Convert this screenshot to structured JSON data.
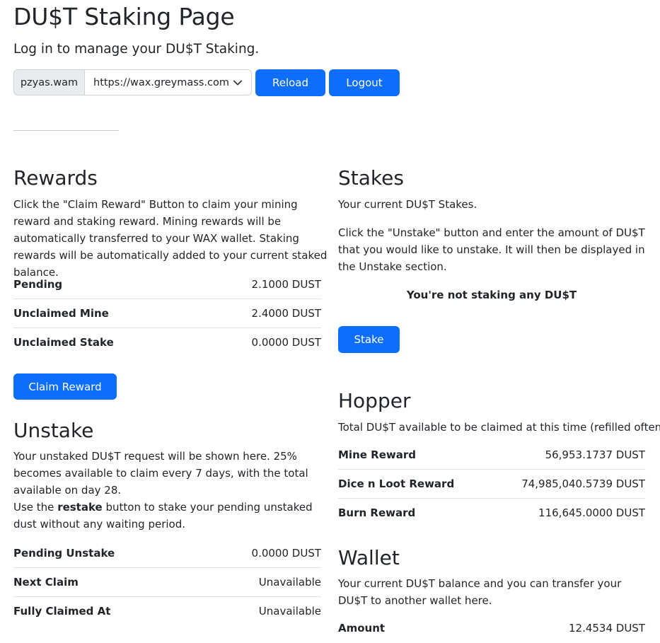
{
  "header": {
    "title": "DU$T Staking Page",
    "subtitle": "Log in to manage your DU$T Staking.",
    "account": "pzyas.wam",
    "endpoint": "https://wax.greymass.com",
    "reload_label": "Reload",
    "logout_label": "Logout"
  },
  "rewards": {
    "title": "Rewards",
    "description": "Click the \"Claim Reward\" Button to claim your mining reward and staking reward. Mining rewards will be automatically transferred to your WAX wallet. Staking rewards will be automatically added to your current staked balance.",
    "rows": [
      {
        "label": "Pending",
        "value": "2.1000 DUST"
      },
      {
        "label": "Unclaimed Mine",
        "value": "2.4000 DUST"
      },
      {
        "label": "Unclaimed Stake",
        "value": "0.0000 DUST"
      }
    ],
    "claim_label": "Claim Reward"
  },
  "unstake": {
    "title": "Unstake",
    "description": "Your unstaked DU$T request will be shown here. 25% becomes available to claim every 7 days, with the total available on day 28.",
    "restake_prefix": "Use the ",
    "restake_word": "restake",
    "restake_suffix": " button to stake your pending unstaked dust without any waiting period.",
    "rows": [
      {
        "label": "Pending Unstake",
        "value": "0.0000 DUST"
      },
      {
        "label": "Next Claim",
        "value": "Unavailable"
      },
      {
        "label": "Fully Claimed At",
        "value": "Unavailable"
      }
    ]
  },
  "stakes": {
    "title": "Stakes",
    "description": "Your current DU$T Stakes.",
    "instructions": "Click the \"Unstake\" button and enter the amount of DU$T that you would like to unstake. It will then be displayed in the Unstake section.",
    "empty_message": "You're not staking any DU$T",
    "stake_label": "Stake"
  },
  "hopper": {
    "title": "Hopper",
    "description": "Total DU$T available to be claimed at this time (refilled often).",
    "rows": [
      {
        "label": "Mine Reward",
        "value": "56,953.1737 DUST"
      },
      {
        "label": "Dice n Loot Reward",
        "value": "74,985,040.5739 DUST"
      },
      {
        "label": "Burn Reward",
        "value": "116,645.0000 DUST"
      }
    ]
  },
  "wallet": {
    "title": "Wallet",
    "description": "Your current DU$T balance and you can transfer your DU$T to another wallet here.",
    "rows": [
      {
        "label": "Amount",
        "value": "12.4534 DUST"
      }
    ]
  },
  "colors": {
    "primary": "#0d6efd",
    "text": "#212529",
    "input_group_bg": "#e9ecef",
    "border": "#ced4da"
  },
  "icons": {
    "select_caret": "chevron-down-icon"
  }
}
